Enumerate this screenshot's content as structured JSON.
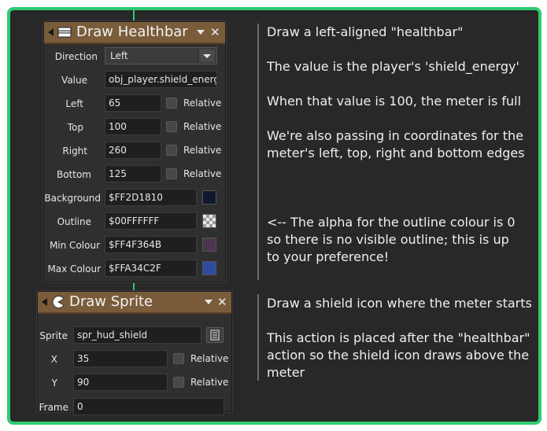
{
  "healthbar": {
    "title": "Draw Healthbar",
    "icon": "healthbar-icon",
    "direction_label": "Direction",
    "direction_value": "Left",
    "value_label": "Value",
    "value_value": "obj_player.shield_energy",
    "left_label": "Left",
    "left_value": "65",
    "top_label": "Top",
    "top_value": "100",
    "right_label": "Right",
    "right_value": "260",
    "bottom_label": "Bottom",
    "bottom_value": "125",
    "relative_label": "Relative",
    "background_label": "Background",
    "background_value": "$FF2D1810",
    "background_color": "#10182D",
    "outline_label": "Outline",
    "outline_value": "$00FFFFFF",
    "mincolour_label": "Min Colour",
    "mincolour_value": "$FF4F364B",
    "mincolour_color": "#4B364F",
    "maxcolour_label": "Max Colour",
    "maxcolour_value": "$FFA34C2F",
    "maxcolour_color": "#2F4CA3"
  },
  "sprite": {
    "title": "Draw Sprite",
    "icon": "pacman-sprite-icon",
    "sprite_label": "Sprite",
    "sprite_value": "spr_hud_shield",
    "x_label": "X",
    "x_value": "35",
    "y_label": "Y",
    "y_value": "90",
    "frame_label": "Frame",
    "frame_value": "0",
    "relative_label": "Relative"
  },
  "notes": {
    "healthbar": [
      "Draw a left-aligned \"healthbar\"",
      "The value is the player's 'shield_energy'",
      "When that value is 100, the meter is full",
      "We're also passing in coordinates for the",
      "meter's left, top, right and bottom edges",
      "<-- The alpha for the outline colour is 0",
      "so there is no visible outline; this is up",
      "to your preference!"
    ],
    "sprite": [
      "Draw a shield icon where the meter starts",
      "This action is placed after the \"healthbar\"",
      "action so the shield icon draws above the",
      "meter"
    ]
  },
  "colors": {
    "frame_border": "#2ecc71",
    "header": "#7a5c3a"
  }
}
